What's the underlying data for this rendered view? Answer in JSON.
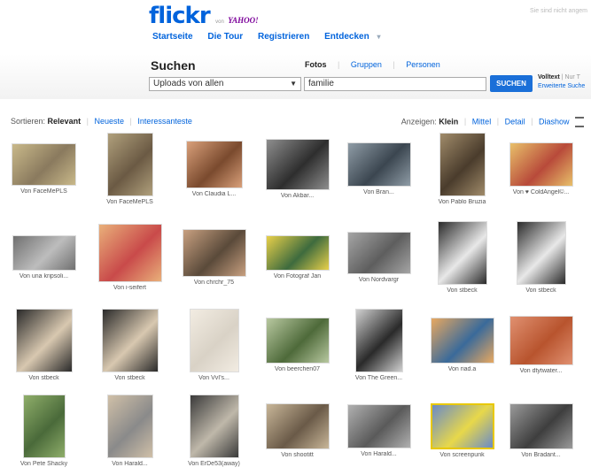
{
  "header": {
    "logo_text": "flickr",
    "logo_by": "von",
    "logo_yahoo": "YAHOO!",
    "top_right": "Sie sind nicht angem",
    "nav": [
      "Startseite",
      "Die Tour",
      "Registrieren",
      "Entdecken"
    ]
  },
  "search": {
    "title": "Suchen",
    "tabs": [
      "Fotos",
      "Gruppen",
      "Personen"
    ],
    "scope_value": "Uploads von allen",
    "query": "familie",
    "button": "SUCHEN",
    "volltext": "Volltext",
    "nur": "| Nur T",
    "advanced": "Erweiterte Suche"
  },
  "sort": {
    "label": "Sortieren:",
    "options": [
      "Relevant",
      "Neueste",
      "Interessanteste"
    ]
  },
  "view": {
    "label": "Anzeigen:",
    "options": [
      "Klein",
      "Mittel",
      "Detail",
      "Diashow"
    ]
  },
  "photos": [
    {
      "caption": "Von FaceMePLS",
      "bg": "#8a7a5e",
      "tint": "#c9b98a"
    },
    {
      "caption": "Von FaceMePLS",
      "bg": "#6b5a44",
      "tint": "#b0a07c"
    },
    {
      "caption": "Von Claudia L...",
      "bg": "#7a4a2e",
      "tint": "#d9a07a"
    },
    {
      "caption": "Von Akbar...",
      "bg": "#2e2e2e",
      "tint": "#8e8e8e"
    },
    {
      "caption": "Von Bran...",
      "bg": "#3b4650",
      "tint": "#8f9ca6"
    },
    {
      "caption": "Von Pablo Bruzia",
      "bg": "#4a3c2c",
      "tint": "#a08b6a"
    },
    {
      "caption": "Von ♥ ColdAngel©...",
      "bg": "#b84a3a",
      "tint": "#e8c06a"
    },
    {
      "caption": "Von una kripsoli...",
      "bg": "#bdbdbd",
      "tint": "#707070"
    },
    {
      "caption": "Von i-seifert",
      "bg": "#c94a4a",
      "tint": "#e9b07a"
    },
    {
      "caption": "Von chrchr_75",
      "bg": "#5a4a3a",
      "tint": "#c8a080"
    },
    {
      "caption": "Von Fotograf Jan",
      "bg": "#3e6b3e",
      "tint": "#e8d04a"
    },
    {
      "caption": "Von Nordvargr",
      "bg": "#5e5e5e",
      "tint": "#a5a5a5"
    },
    {
      "caption": "Von stbeck",
      "bg": "#e8e8e8",
      "tint": "#2a2a2a"
    },
    {
      "caption": "Von stbeck",
      "bg": "#e8e8e8",
      "tint": "#2a2a2a"
    },
    {
      "caption": "Von stbeck",
      "bg": "#d8c8b0",
      "tint": "#2a2a2a"
    },
    {
      "caption": "Von stbeck",
      "bg": "#d8c8b0",
      "tint": "#2a2a2a"
    },
    {
      "caption": "Von VvI's...",
      "bg": "#d9d2c6",
      "tint": "#f2ece2"
    },
    {
      "caption": "Von beerchen07",
      "bg": "#4e6a3a",
      "tint": "#b8c8a0"
    },
    {
      "caption": "Von The Green...",
      "bg": "#2a2a2a",
      "tint": "#d0d0d0"
    },
    {
      "caption": "Von riad.a",
      "bg": "#3a6a9a",
      "tint": "#e8a860"
    },
    {
      "caption": "Von dtytwater...",
      "bg": "#b8542e",
      "tint": "#e09070"
    },
    {
      "caption": "Von Pete Shacky",
      "bg": "#4a6a3a",
      "tint": "#8fae6a"
    },
    {
      "caption": "Von Harald...",
      "bg": "#8a8a8a",
      "tint": "#d0c0a8"
    },
    {
      "caption": "Von ErDe53(away)",
      "bg": "#bfb8aa",
      "tint": "#3a3a3a"
    },
    {
      "caption": "Von shootitt",
      "bg": "#6a5a48",
      "tint": "#c8b698"
    },
    {
      "caption": "Von Harald...",
      "bg": "#5a5a5a",
      "tint": "#b0b0b0"
    },
    {
      "caption": "Von screenpunk",
      "bg": "#e8d84a",
      "tint": "#6a8ac8"
    },
    {
      "caption": "Von Bradant...",
      "bg": "#3e3e3e",
      "tint": "#9a9a9a"
    }
  ]
}
